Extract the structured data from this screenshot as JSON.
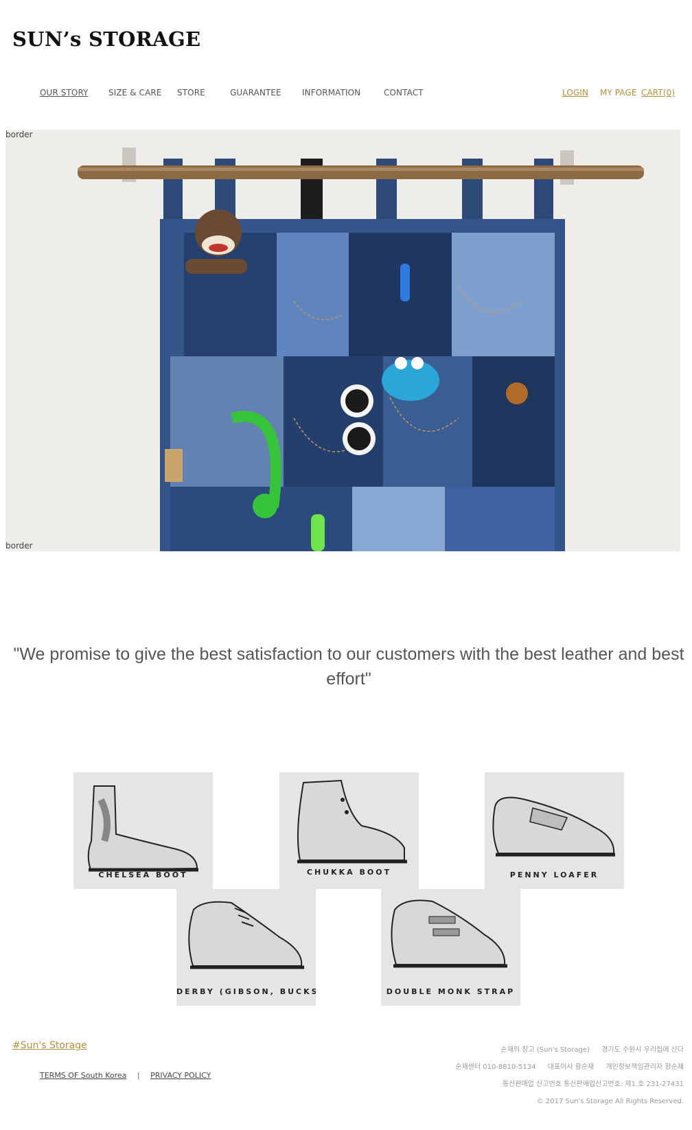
{
  "header": {
    "logo": "SUN’s STORAGE",
    "nav": [
      {
        "label": "OUR STORY"
      },
      {
        "label": "SIZE & CARE"
      },
      {
        "label": "STORE"
      },
      {
        "label": "GUARANTEE"
      },
      {
        "label": "INFORMATION"
      },
      {
        "label": "CONTACT"
      }
    ],
    "util": {
      "login": "LOGIN",
      "mypage": "MY PAGE",
      "cart": "CART(0)"
    }
  },
  "hero": {
    "alt_top": "border",
    "alt_bottom": "border"
  },
  "quote": "\"We promise to give the best satisfaction to our customers with the best leather and best effort\"",
  "shoes": [
    {
      "label": "CHELSEA BOOT"
    },
    {
      "label": "CHUKKA BOOT"
    },
    {
      "label": "PENNY LOAFER"
    },
    {
      "label": "DERBY (GIBSON, BUCKS)"
    },
    {
      "label": "DOUBLE MONK STRAP"
    }
  ],
  "footer": {
    "brand": "#Sun's Storage",
    "terms": "TERMS OF South Korea",
    "sep": "|",
    "privacy": "PRIVACY POLICY",
    "info": [
      [
        "순재의 창고 (Sun's Storage)",
        "경기도 수원시 우리집에 산다"
      ],
      [
        "순재센터 010-8810-5134",
        "대표이사 황순재",
        "개인정보책임관리자 황순재"
      ],
      [
        "통신판매업 신고번호 통신판매업신고번호: 제1 호 231-27431"
      ],
      [
        "© 2017 Sun's Storage All Rights Reserved."
      ]
    ]
  }
}
